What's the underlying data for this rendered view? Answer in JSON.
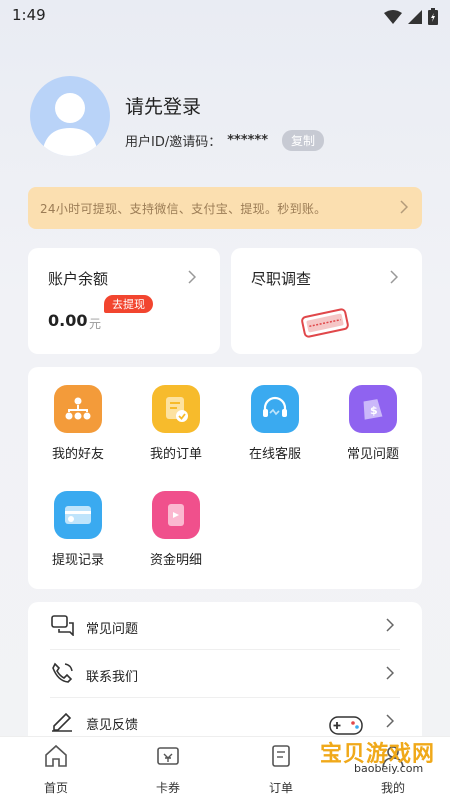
{
  "status": {
    "time": "1:49"
  },
  "profile": {
    "login_title": "请先登录",
    "invite_label": "用户ID/邀请码：",
    "invite_code": "******",
    "copy_label": "复制"
  },
  "notice": {
    "text": "24小时可提现、支持微信、支付宝、提现。秒到账。"
  },
  "balance": {
    "title": "账户余额",
    "badge": "去提现",
    "amount": "0.00",
    "unit": "元"
  },
  "survey": {
    "title": "尽职调查"
  },
  "grid": {
    "items": [
      {
        "label": "我的好友",
        "icon": "friends-icon",
        "color": "#f39b3a"
      },
      {
        "label": "我的订单",
        "icon": "orders-icon",
        "color": "#f7bb2c"
      },
      {
        "label": "在线客服",
        "icon": "customer-service-icon",
        "color": "#3aaaf0"
      },
      {
        "label": "常见问题",
        "icon": "faq-icon",
        "color": "#8f63f0"
      },
      {
        "label": "提现记录",
        "icon": "withdraw-record-icon",
        "color": "#3aaaf0"
      },
      {
        "label": "资金明细",
        "icon": "fund-detail-icon",
        "color": "#f0508c"
      }
    ]
  },
  "list": {
    "items": [
      {
        "label": "常见问题",
        "icon": "chat-bubbles-icon"
      },
      {
        "label": "联系我们",
        "icon": "phone-icon"
      },
      {
        "label": "意见反馈",
        "icon": "pen-icon"
      }
    ]
  },
  "tabbar": {
    "items": [
      {
        "label": "首页",
        "icon": "home-icon"
      },
      {
        "label": "卡券",
        "icon": "coupon-icon"
      },
      {
        "label": "订单",
        "icon": "order-tab-icon"
      },
      {
        "label": "我的",
        "icon": "profile-icon"
      }
    ]
  },
  "watermark": {
    "text": "宝贝游戏网",
    "url": "baobeiy.com"
  }
}
